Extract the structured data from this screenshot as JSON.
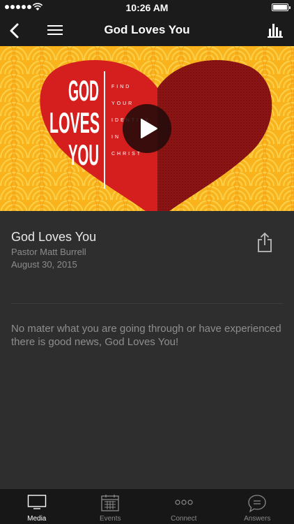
{
  "status_bar": {
    "time": "10:26 AM"
  },
  "nav": {
    "title": "God Loves You"
  },
  "hero": {
    "artwork_title_lines": [
      "GOD",
      "LOVES",
      "YOU"
    ],
    "artwork_subtitle_lines": [
      "FIND",
      "YOUR",
      "IDENTITY",
      "IN",
      "CHRIST"
    ]
  },
  "media": {
    "title": "God Loves You",
    "speaker": "Pastor Matt Burrell",
    "date": "August 30, 2015",
    "description": "No mater what you are going through or have experienced there is good news, God Loves You!"
  },
  "tabs": [
    {
      "label": "Media",
      "icon": "tv-icon",
      "active": true
    },
    {
      "label": "Events",
      "icon": "calendar-icon",
      "active": false
    },
    {
      "label": "Connect",
      "icon": "more-dots-icon",
      "active": false
    },
    {
      "label": "Answers",
      "icon": "chat-bubble-icon",
      "active": false
    }
  ],
  "colors": {
    "hero_bg": "#f9b41d",
    "heart_left": "#d51f1f",
    "heart_right": "#8c1414",
    "content_bg": "#2e2e2e"
  }
}
